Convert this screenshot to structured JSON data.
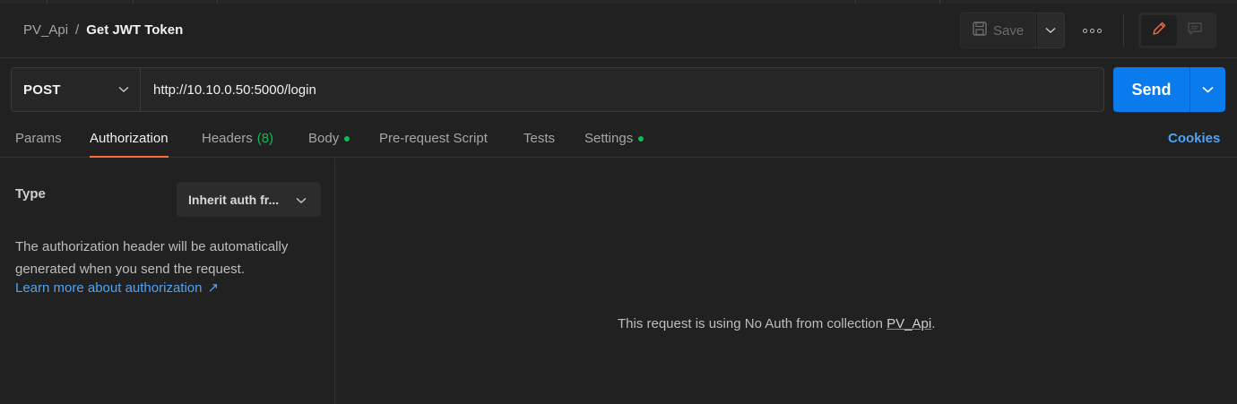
{
  "breadcrumb": {
    "parent": "PV_Api",
    "separator": "/",
    "current": "Get JWT Token"
  },
  "toolbar": {
    "save_label": "Save"
  },
  "request": {
    "method": "POST",
    "url": "http://10.10.0.50:5000/login",
    "send_label": "Send"
  },
  "tabs": [
    {
      "label": "Params"
    },
    {
      "label": "Authorization"
    },
    {
      "label": "Headers",
      "count": "(8)"
    },
    {
      "label": "Body"
    },
    {
      "label": "Pre-request Script"
    },
    {
      "label": "Tests"
    },
    {
      "label": "Settings"
    }
  ],
  "cookies_label": "Cookies",
  "auth": {
    "type_label": "Type",
    "type_value": "Inherit auth fr...",
    "description": "The authorization header will be automatically generated when you send the request.",
    "learn_more": "Learn more about authorization",
    "learn_more_arrow": "↗",
    "message_prefix": "This request is using No Auth from collection",
    "message_link": "PV_Api",
    "message_suffix": "."
  },
  "colors": {
    "accent_send": "#097bed",
    "tab_indicator": "#ff6c37",
    "status_dot": "#0cbb52",
    "link": "#4ea3f5"
  }
}
